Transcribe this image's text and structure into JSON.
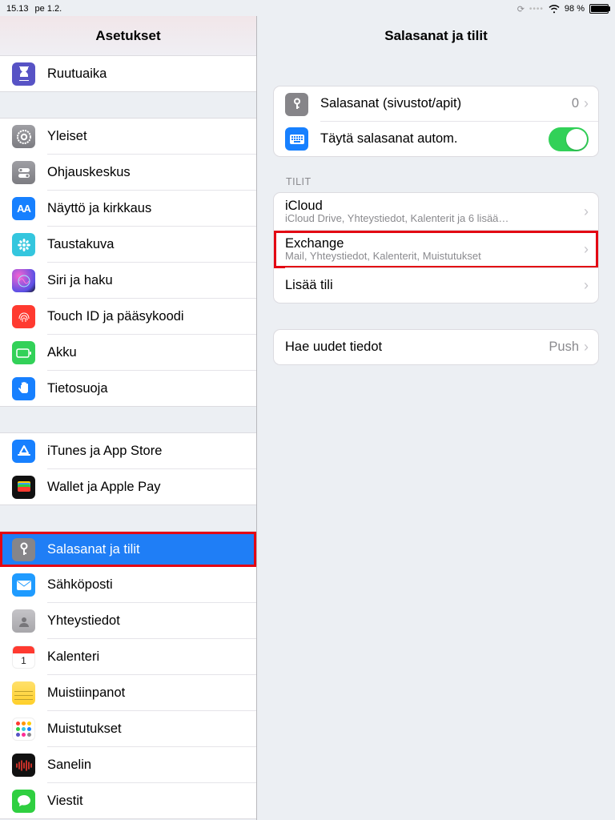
{
  "status": {
    "time": "15.13",
    "date": "pe 1.2.",
    "battery_pct": "98 %"
  },
  "sidebar": {
    "title": "Asetukset",
    "groups": [
      {
        "items": [
          {
            "key": "screentime",
            "label": "Ruutuaika"
          }
        ]
      },
      {
        "items": [
          {
            "key": "general",
            "label": "Yleiset"
          },
          {
            "key": "controlcenter",
            "label": "Ohjauskeskus"
          },
          {
            "key": "display",
            "label": "Näyttö ja kirkkaus"
          },
          {
            "key": "wallpaper",
            "label": "Taustakuva"
          },
          {
            "key": "siri",
            "label": "Siri ja haku"
          },
          {
            "key": "touchid",
            "label": "Touch ID ja pääsykoodi"
          },
          {
            "key": "battery",
            "label": "Akku"
          },
          {
            "key": "privacy",
            "label": "Tietosuoja"
          }
        ]
      },
      {
        "items": [
          {
            "key": "itunes",
            "label": "iTunes ja App Store"
          },
          {
            "key": "wallet",
            "label": "Wallet ja Apple Pay"
          }
        ]
      },
      {
        "items": [
          {
            "key": "passwords",
            "label": "Salasanat ja tilit",
            "selected": true
          },
          {
            "key": "mail",
            "label": "Sähköposti"
          },
          {
            "key": "contacts",
            "label": "Yhteystiedot"
          },
          {
            "key": "calendar",
            "label": "Kalenteri"
          },
          {
            "key": "notes",
            "label": "Muistiinpanot"
          },
          {
            "key": "reminders",
            "label": "Muistutukset"
          },
          {
            "key": "voice",
            "label": "Sanelin"
          },
          {
            "key": "messages",
            "label": "Viestit"
          }
        ]
      }
    ]
  },
  "detail": {
    "title": "Salasanat ja tilit",
    "passwords_label": "Salasanat (sivustot/apit)",
    "passwords_count": "0",
    "autofill_label": "Täytä salasanat autom.",
    "accounts_header": "TILIT",
    "accounts": [
      {
        "title": "iCloud",
        "sub": "iCloud Drive, Yhteystiedot, Kalenterit ja 6 lisää…"
      },
      {
        "title": "Exchange",
        "sub": "Mail, Yhteystiedot, Kalenterit, Muistutukset",
        "highlight": true
      },
      {
        "title": "Lisää tili"
      }
    ],
    "fetch_label": "Hae uudet tiedot",
    "fetch_value": "Push"
  }
}
